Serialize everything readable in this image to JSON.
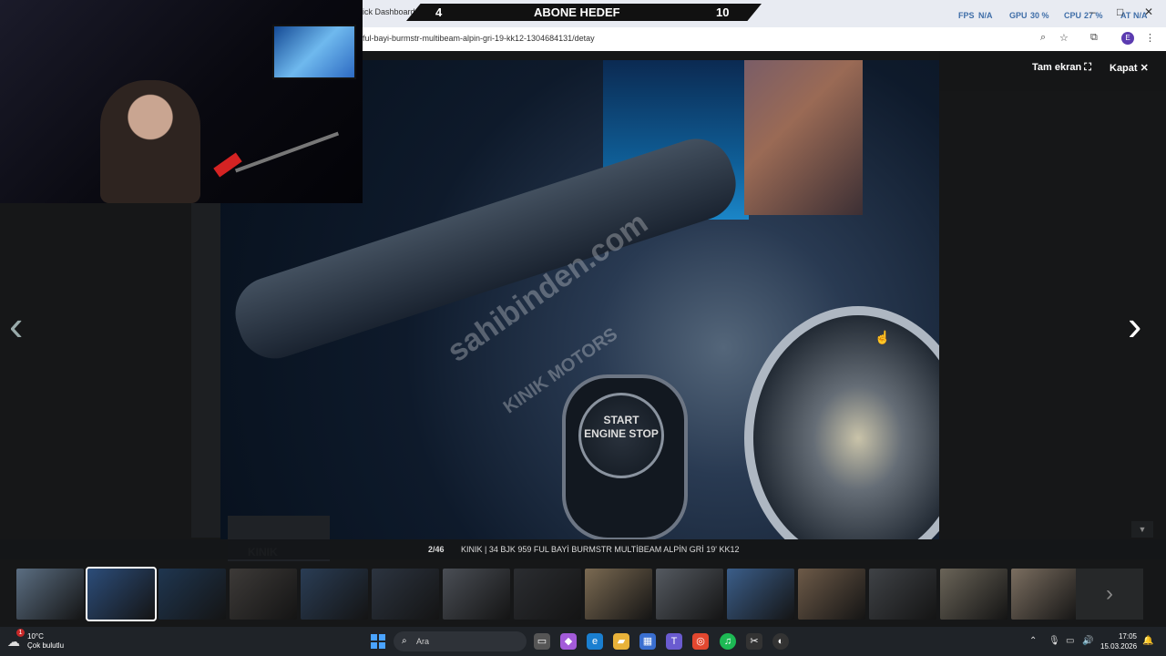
{
  "browser": {
    "tab_title": "ick Dashboard",
    "url": "ful-bayi-burmstr-multibeam-alpin-gri-19-kk12-1304684131/detay",
    "stats": [
      "FPS",
      "N/A",
      "GPU",
      "30 %",
      "CPU",
      "27 %",
      "AT",
      "N/A"
    ],
    "avatar_letter": "E"
  },
  "overlay_banner": {
    "left": "4",
    "title": "ABONE HEDEF",
    "right": "10"
  },
  "viewer": {
    "fullscreen_label": "Tam ekran",
    "close_label": "Kapat",
    "counter": "2/46",
    "caption": "KINIK | 34 BJK 959 FUL BAYİ BURMSTR MULTİBEAM ALPİN GRİ 19' KK12",
    "watermark": "sahibinden.com",
    "watermark2": "KINIK MOTORS",
    "brand": "KINIK",
    "engine_button": "START ENGINE STOP",
    "thumbnail_colors": [
      "#5b6e82",
      "#2c4d7a",
      "#1f3650",
      "#3d3a38",
      "#2a3d55",
      "#2c3440",
      "#4a4e55",
      "#2b2d31",
      "#7b6a52",
      "#555a61",
      "#3b5e8a",
      "#6d5a48",
      "#3f4246",
      "#6a6458",
      "#7b6e60"
    ]
  },
  "taskbar": {
    "weather_temp": "10°C",
    "weather_desc": "Çok bulutlu",
    "weather_badge": "1",
    "search_placeholder": "Ara",
    "time": "17:05",
    "date": "15.03.2026"
  }
}
